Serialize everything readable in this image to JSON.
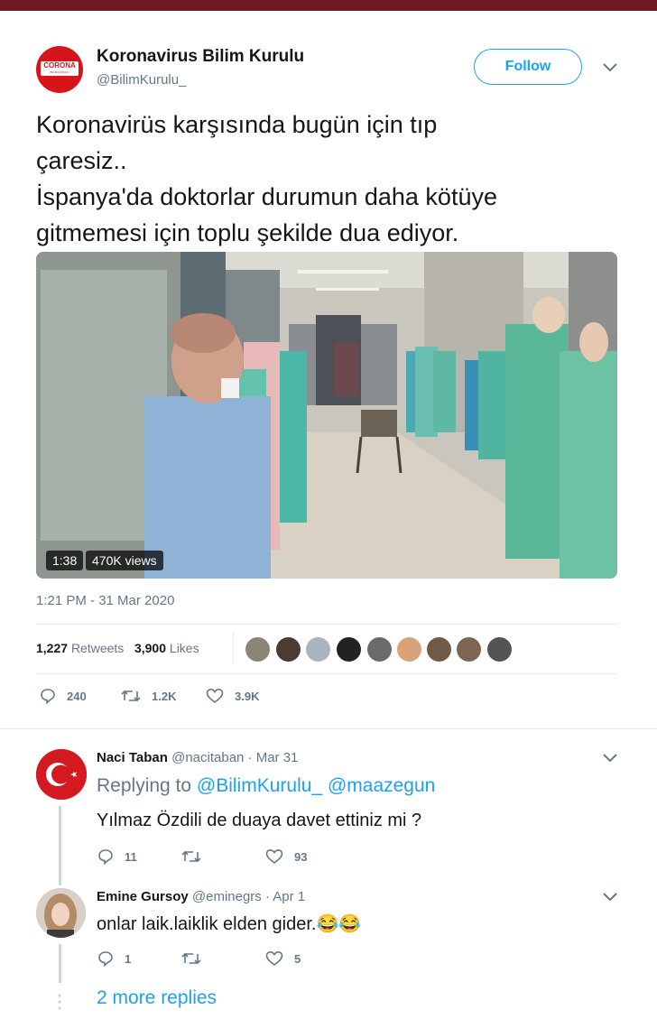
{
  "tweet": {
    "author_name": "Koronavirus Bilim Kurulu",
    "author_handle": "@BilimKurulu_",
    "avatar_text": "CORONA",
    "avatar_subtext": "BİLİM KURULU",
    "follow_label": "Follow",
    "text_lines": [
      "Koronavirüs karşısında bugün için tıp",
      "çaresiz..",
      "İspanya'da doktorlar durumun daha kötüye",
      "gitmemesi için toplu şekilde dua ediyor."
    ],
    "video": {
      "duration": "1:38",
      "views": "470K views"
    },
    "timestamp": "1:21 PM - 31 Mar 2020",
    "retweets_count": "1,227",
    "retweets_label": "Retweets",
    "likes_count": "3,900",
    "likes_label": "Likes",
    "actions": {
      "replies": "240",
      "retweets": "1.2K",
      "likes": "3.9K"
    }
  },
  "replies": [
    {
      "name": "Naci Taban",
      "handle": "@nacitaban",
      "date": "· Mar 31",
      "replying_prefix": "Replying to",
      "replying_to": [
        "@BilimKurulu_",
        "@maazegun"
      ],
      "text": "Yılmaz Özdili de duaya davet ettiniz mi ?",
      "replies": "11",
      "retweets": "",
      "likes": "93"
    },
    {
      "name": "Emine Gursoy",
      "handle": "@eminegrs",
      "date": "· Apr 1",
      "text": "onlar laik.laiklik elden gider.😂😂",
      "replies": "1",
      "retweets": "",
      "likes": "5"
    }
  ],
  "more_replies": "2 more replies",
  "colors": {
    "accent": "#1da1f2",
    "text": "#14171a",
    "secondary": "#657786",
    "top_bar": "#6d1a22",
    "avatar_red": "#d8141b"
  },
  "icons": [
    "chevron-down-icon",
    "reply-icon",
    "retweet-icon",
    "heart-icon",
    "turkish-flag-icon",
    "thread-dots-icon"
  ]
}
